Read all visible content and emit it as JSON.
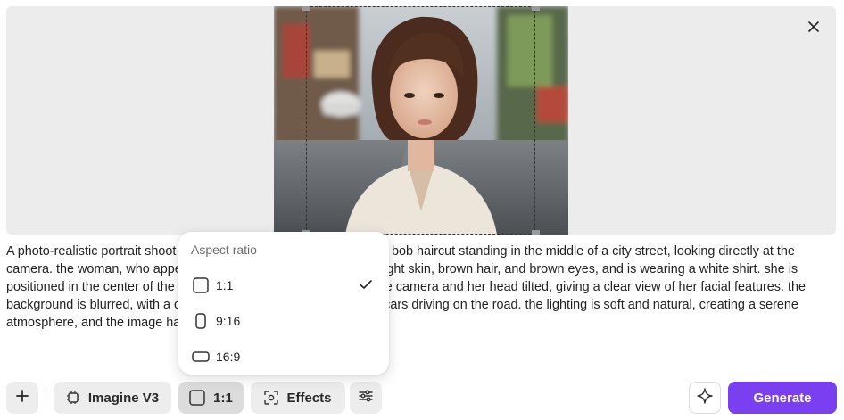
{
  "preview": {
    "close_icon": "close-icon"
  },
  "prompt": {
    "text": "A photo-realistic portrait shoot of a young asian woman with a short bob haircut standing in the middle of a city street, looking directly at the camera. the woman, who appears to be in her early twenties, has light skin, brown hair, and brown eyes, and is wearing a white shirt. she is positioned in the center of the image, with her upper body facing the camera and her head tilted, giving a clear view of her facial features. the background is blurred, with a cityscape featuring tall buildings and cars driving on the road. the lighting is soft and natural, creating a serene atmosphere, and the image has a high-quality feel."
  },
  "aspect_menu": {
    "title": "Aspect ratio",
    "options": [
      {
        "label": "1:1",
        "icon": "square-ratio-icon",
        "selected": true
      },
      {
        "label": "9:16",
        "icon": "portrait-ratio-icon",
        "selected": false
      },
      {
        "label": "16:9",
        "icon": "landscape-ratio-icon",
        "selected": false
      }
    ]
  },
  "toolbar": {
    "add_icon": "plus-icon",
    "model_label": "Imagine V3",
    "model_icon": "chip-icon",
    "ratio_label": "1:1",
    "ratio_icon": "square-ratio-icon",
    "effects_label": "Effects",
    "effects_icon": "effects-icon",
    "settings_icon": "sliders-icon",
    "enhance_icon": "sparkle-icon",
    "generate_label": "Generate"
  },
  "colors": {
    "accent": "#7b3ff2",
    "preview_bg": "#ececec",
    "button_bg": "#ededed"
  }
}
